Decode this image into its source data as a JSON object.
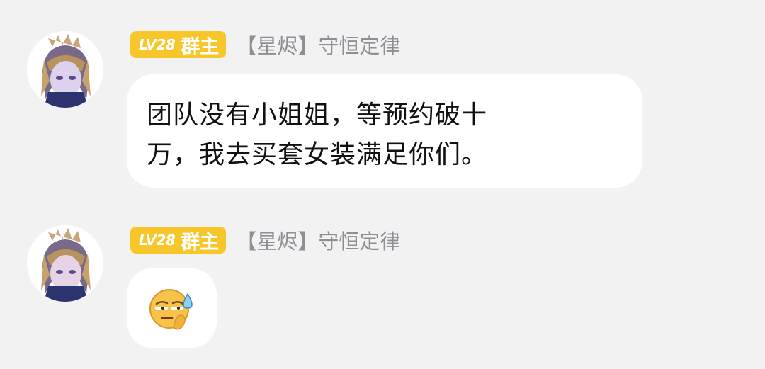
{
  "messages": [
    {
      "level": "LV28",
      "role": "群主",
      "sender": "【星烬】守恒定律",
      "lines": [
        "团队没有小姐姐，等预约破十",
        "万，我去买套女装满足你们。"
      ]
    },
    {
      "level": "LV28",
      "role": "群主",
      "sender": "【星烬】守恒定律",
      "emoji": "sweat-smirk-emoji"
    }
  ],
  "colors": {
    "background": "#f2f2f3",
    "bubble": "#ffffff",
    "badge": "#f7c62a",
    "name": "#8e8e95",
    "text": "#111111"
  }
}
